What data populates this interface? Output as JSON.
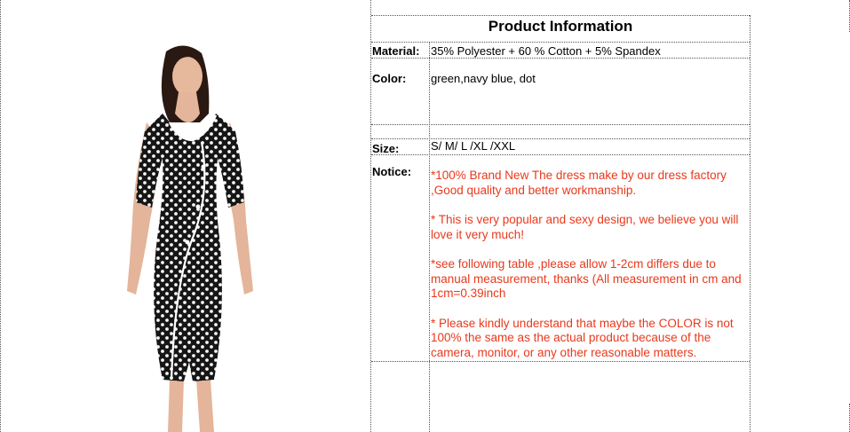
{
  "product_image": {
    "description_icon": "dress-model-photo",
    "colors": {
      "dress": "#161616",
      "dots": "#f4f4f4",
      "piping": "#ffffff",
      "skin": "#e4b59a",
      "hair": "#2a1812"
    }
  },
  "table": {
    "title": "Product Information",
    "rows": {
      "material": {
        "label": "Material:",
        "value": "35% Polyester + 60 % Cotton + 5% Spandex"
      },
      "color": {
        "label": "Color:",
        "value": "green,navy blue, dot"
      },
      "size": {
        "label": "Size:",
        "value": "S/ M/ L /XL /XXL"
      },
      "notice": {
        "label": "Notice:",
        "paragraphs": [
          "*100% Brand New  The dress make by our dress factory ,Good quality and better workmanship.",
          "* This is very popular and sexy design, we believe you will love it very much!",
          "*see following  table ,please allow 1-2cm differs due to manual measurement, thanks (All measurement in cm and 1cm=0.39inch",
          "* Please kindly understand that maybe the COLOR is not 100% the same as the actual product because of the camera, monitor, or any other reasonable matters."
        ]
      }
    },
    "notice_color": "#e8391c"
  }
}
